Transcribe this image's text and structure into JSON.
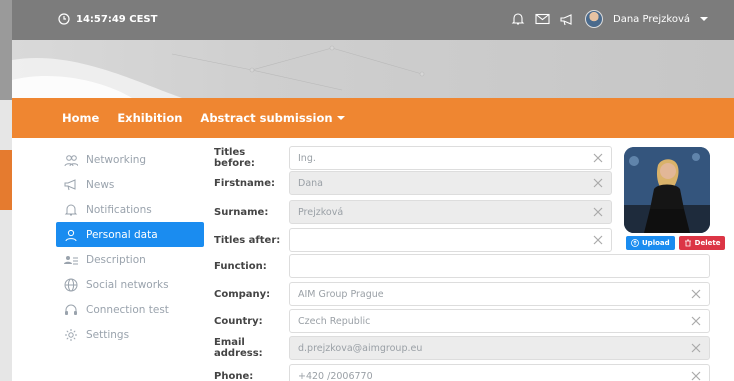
{
  "topbar": {
    "time": "14:57:49 CEST",
    "user_name": "Dana Prejzková"
  },
  "nav": {
    "items": [
      {
        "label": "Home"
      },
      {
        "label": "Exhibition"
      },
      {
        "label": "Abstract submission"
      }
    ]
  },
  "sidebar": {
    "items": [
      {
        "label": "Networking",
        "icon": "people-icon"
      },
      {
        "label": "News",
        "icon": "megaphone-icon"
      },
      {
        "label": "Notifications",
        "icon": "bell-icon"
      },
      {
        "label": "Personal data",
        "icon": "user-icon",
        "active": true
      },
      {
        "label": "Description",
        "icon": "list-user-icon"
      },
      {
        "label": "Social networks",
        "icon": "globe-icon"
      },
      {
        "label": "Connection test",
        "icon": "headset-icon"
      },
      {
        "label": "Settings",
        "icon": "gear-icon"
      }
    ]
  },
  "form": {
    "titles_before": {
      "label": "Titles before:",
      "value": "Ing."
    },
    "firstname": {
      "label": "Firstname:",
      "value": "Dana"
    },
    "surname": {
      "label": "Surname:",
      "value": "Prejzková"
    },
    "titles_after": {
      "label": "Titles after:",
      "value": ""
    },
    "function": {
      "label": "Function:",
      "value": ""
    },
    "company": {
      "label": "Company:",
      "value": "AIM Group Prague"
    },
    "country": {
      "label": "Country:",
      "value": "Czech Republic"
    },
    "email": {
      "label": "Email address:",
      "value": "d.prejzkova@aimgroup.eu"
    },
    "phone": {
      "label": "Phone:",
      "value": "+420 /2006770"
    }
  },
  "photo": {
    "upload_label": "Upload",
    "delete_label": "Delete"
  },
  "colors": {
    "accent_orange": "#ef8631",
    "active_blue": "#1a8cf0",
    "delete_red": "#dc3545"
  }
}
